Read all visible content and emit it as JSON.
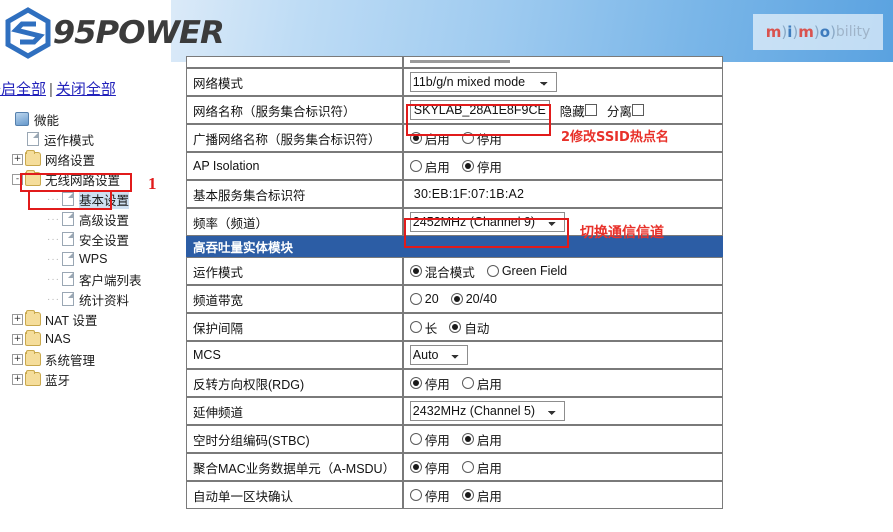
{
  "brand": {
    "logo_text": "95POWER",
    "logo_mark": "hexagon-s-logo",
    "right_logo": {
      "l1": "m",
      "p1": ")",
      "l2": "i",
      "p2": ")",
      "l3": "m",
      "p3": ")",
      "l4": "o",
      "p4": ")",
      "rest": "bility"
    }
  },
  "sidebar": {
    "expand_all": "开启全部",
    "separator": "|",
    "collapse_all": "关闭全部",
    "tree": [
      {
        "label": "微能",
        "level": 1,
        "icon": "root-icon",
        "expander": "",
        "selected": false
      },
      {
        "label": "运作模式",
        "level": 2,
        "icon": "doc-icon",
        "expander": "",
        "selected": false
      },
      {
        "label": "网络设置",
        "level": 2,
        "icon": "folder-icon",
        "expander": "+",
        "selected": false
      },
      {
        "label": "无线网路设置",
        "level": 2,
        "icon": "folder-icon",
        "expander": "-",
        "selected": false
      },
      {
        "label": "基本设置",
        "level": 3,
        "icon": "doc-icon",
        "expander": "",
        "selected": true
      },
      {
        "label": "高级设置",
        "level": 3,
        "icon": "doc-icon",
        "expander": "",
        "selected": false
      },
      {
        "label": "安全设置",
        "level": 3,
        "icon": "doc-icon",
        "expander": "",
        "selected": false
      },
      {
        "label": "WPS",
        "level": 3,
        "icon": "doc-icon",
        "expander": "",
        "selected": false
      },
      {
        "label": "客户端列表",
        "level": 3,
        "icon": "doc-icon",
        "expander": "",
        "selected": false
      },
      {
        "label": "统计资料",
        "level": 3,
        "icon": "doc-icon",
        "expander": "",
        "selected": false
      },
      {
        "label": "NAT 设置",
        "level": 2,
        "icon": "folder-icon",
        "expander": "+",
        "selected": false
      },
      {
        "label": "NAS",
        "level": 2,
        "icon": "folder-icon",
        "expander": "+",
        "selected": false
      },
      {
        "label": "系统管理",
        "level": 2,
        "icon": "folder-icon",
        "expander": "+",
        "selected": false
      },
      {
        "label": "蓝牙",
        "level": 2,
        "icon": "folder-icon",
        "expander": "+",
        "selected": false
      }
    ]
  },
  "annotations": {
    "step1_number": "1",
    "ssid_note": "2修改SSID热点名",
    "channel_note": "切换通信信道",
    "color": "#e8312a"
  },
  "form": {
    "rows": [
      {
        "label": "网络模式",
        "type": "select",
        "value": "11b/g/n mixed mode",
        "width": "w-mode"
      },
      {
        "label": "网络名称（服务集合标识符）",
        "type": "ssid",
        "value": "SKYLAB_28A1E8F9CE",
        "hide_label": "隐藏",
        "hide_checked": false,
        "isolate_label": "分离",
        "isolate_checked": false
      },
      {
        "label": "广播网络名称（服务集合标识符）",
        "type": "radio",
        "options": [
          {
            "text": "启用",
            "on": true
          },
          {
            "text": "停用",
            "on": false
          }
        ]
      },
      {
        "label": "AP Isolation",
        "type": "radio",
        "options": [
          {
            "text": "启用",
            "on": false
          },
          {
            "text": "停用",
            "on": true
          }
        ]
      },
      {
        "label": "基本服务集合标识符",
        "type": "text",
        "value": "30:EB:1F:07:1B:A2"
      },
      {
        "label": "频率（频道）",
        "type": "select",
        "value": "2452MHz (Channel 9)",
        "width": "w-chan"
      },
      {
        "label": "高吞吐量实体模块",
        "type": "section"
      },
      {
        "label": "运作模式",
        "type": "radio",
        "options": [
          {
            "text": "混合模式",
            "on": true
          },
          {
            "text": "Green Field",
            "on": false
          }
        ]
      },
      {
        "label": "频道带宽",
        "type": "radio",
        "options": [
          {
            "text": "20",
            "on": false
          },
          {
            "text": "20/40",
            "on": true
          }
        ]
      },
      {
        "label": "保护间隔",
        "type": "radio",
        "options": [
          {
            "text": "长",
            "on": false
          },
          {
            "text": "自动",
            "on": true
          }
        ]
      },
      {
        "label": "MCS",
        "type": "select",
        "value": "Auto",
        "width": "w-mcs"
      },
      {
        "label": "反转方向权限(RDG)",
        "type": "radio",
        "options": [
          {
            "text": "停用",
            "on": true
          },
          {
            "text": "启用",
            "on": false
          }
        ]
      },
      {
        "label": "延伸频道",
        "type": "select",
        "value": "2432MHz (Channel 5)",
        "width": "w-ext"
      },
      {
        "label": "空时分组编码(STBC)",
        "type": "radio",
        "options": [
          {
            "text": "停用",
            "on": false
          },
          {
            "text": "启用",
            "on": true
          }
        ]
      },
      {
        "label": "聚合MAC业务数据单元（A-MSDU）",
        "type": "radio",
        "options": [
          {
            "text": "停用",
            "on": true
          },
          {
            "text": "启用",
            "on": false
          }
        ]
      },
      {
        "label": "自动单一区块确认",
        "type": "radio",
        "options": [
          {
            "text": "停用",
            "on": false
          },
          {
            "text": "启用",
            "on": true
          }
        ]
      }
    ]
  }
}
